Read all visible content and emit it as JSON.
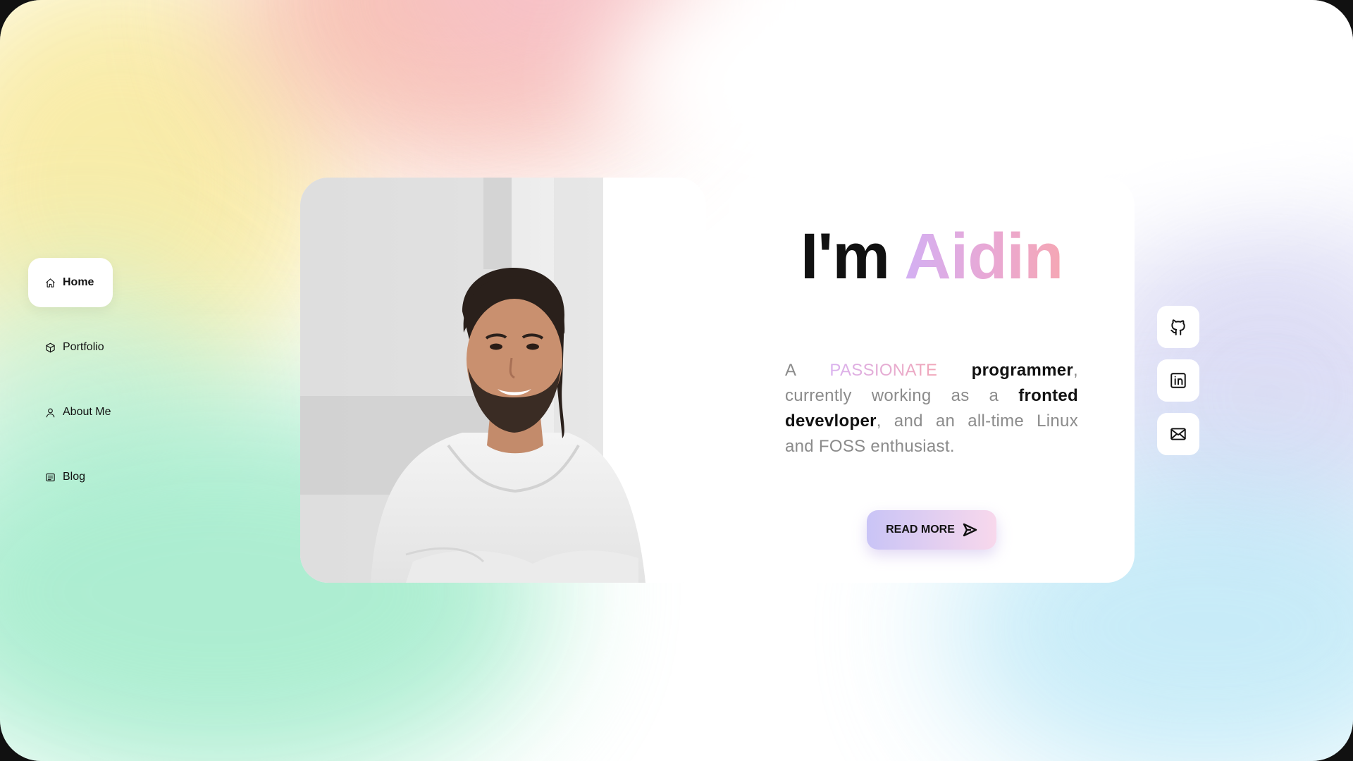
{
  "nav": {
    "items": [
      {
        "label": "Home",
        "icon": "home-icon",
        "active": true
      },
      {
        "label": "Portfolio",
        "icon": "box-icon",
        "active": false
      },
      {
        "label": "About Me",
        "icon": "user-icon",
        "active": false
      },
      {
        "label": "Blog",
        "icon": "newspaper-icon",
        "active": false
      }
    ]
  },
  "hero": {
    "greeting": "I'm",
    "name": "Aidin",
    "desc": {
      "a": "A",
      "highlight": "PASSIONATE",
      "role": "programmer",
      "mid": ", currently working as a",
      "job": "fronted devevloper",
      "end": ", and an all-time Linux and FOSS enthusiast."
    },
    "cta_label": "READ MORE",
    "photo_icon": "portrait-photo"
  },
  "social": [
    {
      "icon": "github-icon"
    },
    {
      "icon": "linkedin-icon"
    },
    {
      "icon": "mail-icon"
    }
  ],
  "colors": {
    "name_gradient": [
      "#d3b0f3",
      "#f5a7b4"
    ],
    "cta_gradient": [
      "#c9c4f6",
      "#f8d8ec"
    ]
  }
}
